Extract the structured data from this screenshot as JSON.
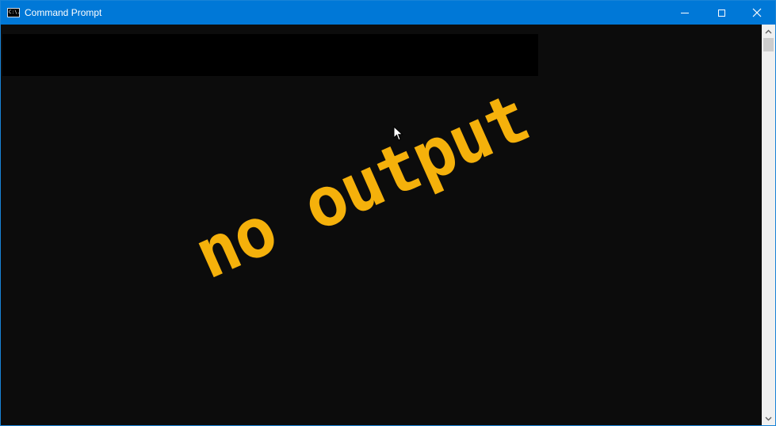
{
  "window": {
    "title": "Command Prompt",
    "icon": "cmd-icon",
    "icon_text": "C:\\."
  },
  "caption_buttons": {
    "minimize_icon": "minimize-icon",
    "maximize_icon": "maximize-icon",
    "close_icon": "close-icon"
  },
  "console": {
    "background": "#0c0c0c",
    "stamp_text": "no output",
    "stamp_color": "#f5b10b"
  },
  "colors": {
    "titlebar": "#0078d7",
    "scrollbar": "#f0f0f0"
  }
}
